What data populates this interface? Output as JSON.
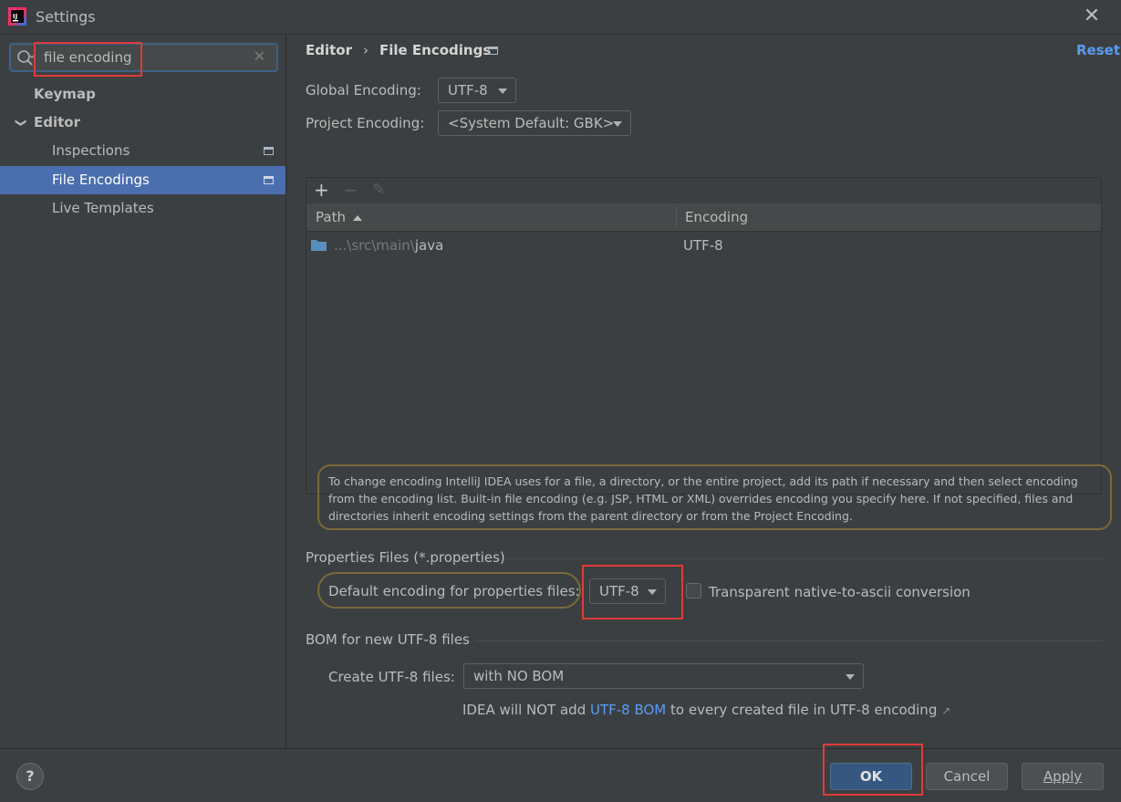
{
  "window": {
    "title": "Settings",
    "close_glyph": "✕"
  },
  "sidebar": {
    "search": {
      "value": "file encoding",
      "clear_glyph": "✕"
    },
    "items": [
      {
        "label": "Keymap"
      },
      {
        "label": "Editor",
        "expanded_glyph": "❯"
      },
      {
        "label": "Inspections"
      },
      {
        "label": "File Encodings",
        "selected": true
      },
      {
        "label": "Live Templates"
      }
    ]
  },
  "header": {
    "breadcrumb_parent": "Editor",
    "breadcrumb_sep": "›",
    "breadcrumb_current": "File Encodings",
    "reset_label": "Reset"
  },
  "encodings": {
    "global_label": "Global Encoding:",
    "global_value": "UTF-8",
    "project_label": "Project Encoding:",
    "project_value": "<System Default: GBK>"
  },
  "table": {
    "toolbar": {
      "add": "+",
      "remove": "−",
      "edit": "✎"
    },
    "columns": [
      "Path",
      "Encoding"
    ],
    "rows": [
      {
        "path_prefix": "...\\src\\main\\",
        "path_name": "java",
        "encoding": "UTF-8"
      }
    ]
  },
  "note": "To change encoding IntelliJ IDEA uses for a file, a directory, or the entire project, add its path if necessary and then select encoding from the encoding list. Built-in file encoding (e.g. JSP, HTML or XML) overrides encoding you specify here. If not specified, files and directories inherit encoding settings from the parent directory or from the Project Encoding.",
  "properties": {
    "section_title": "Properties Files (*.properties)",
    "default_label": "Default encoding for properties files:",
    "default_value": "UTF-8",
    "transparent_label": "Transparent native-to-ascii conversion",
    "transparent_checked": false
  },
  "bom": {
    "section_title": "BOM for new UTF-8 files",
    "create_label": "Create UTF-8 files:",
    "create_value": "with NO BOM",
    "info_pre": "IDEA will NOT add ",
    "info_link": "UTF-8 BOM",
    "info_post": " to every created file in UTF-8 encoding",
    "info_ext_glyph": "↗"
  },
  "footer": {
    "help_label": "?",
    "ok_label": "OK",
    "cancel_label": "Cancel",
    "apply_label": "Apply"
  },
  "colors": {
    "selection": "#4b6eaf",
    "link": "#589df6",
    "annotation_red": "#e03a3a",
    "primary_button": "#365880"
  }
}
